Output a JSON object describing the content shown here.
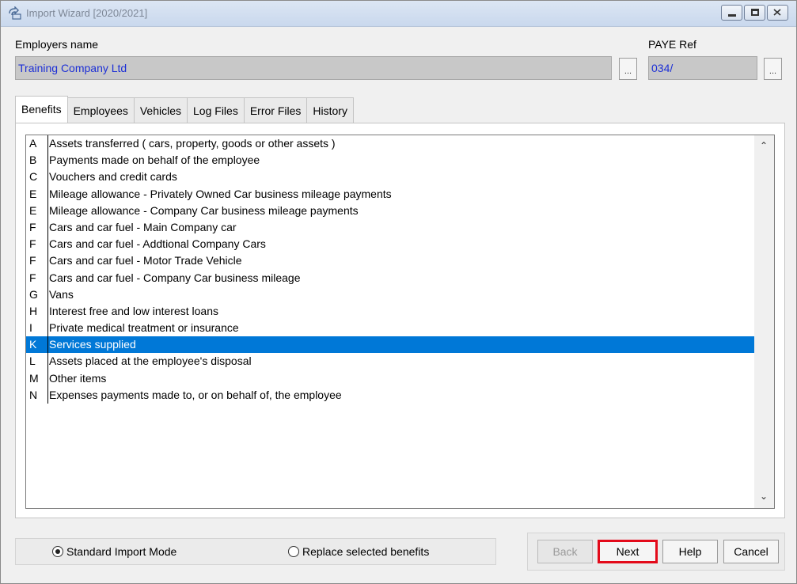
{
  "window": {
    "title": "Import Wizard [2020/2021]"
  },
  "header": {
    "employers_label": "Employers name",
    "employers_value": "Training Company Ltd",
    "paye_label": "PAYE Ref",
    "paye_value": "034/",
    "browse_label": "..."
  },
  "tabs": [
    "Benefits",
    "Employees",
    "Vehicles",
    "Log Files",
    "Error Files",
    "History"
  ],
  "benefits": [
    {
      "code": "A",
      "desc": "Assets transferred ( cars, property, goods or other assets )"
    },
    {
      "code": "B",
      "desc": "Payments made on behalf of the employee"
    },
    {
      "code": "C",
      "desc": "Vouchers and credit cards"
    },
    {
      "code": "E",
      "desc": "Mileage allowance - Privately Owned Car business mileage payments"
    },
    {
      "code": "E",
      "desc": "Mileage allowance - Company Car business mileage payments"
    },
    {
      "code": "F",
      "desc": "Cars and car fuel - Main Company car"
    },
    {
      "code": "F",
      "desc": "Cars and car fuel - Addtional Company Cars"
    },
    {
      "code": "F",
      "desc": "Cars and car fuel - Motor Trade Vehicle"
    },
    {
      "code": "F",
      "desc": "Cars and car fuel - Company Car business mileage"
    },
    {
      "code": "G",
      "desc": "Vans"
    },
    {
      "code": "H",
      "desc": "Interest free and low interest loans"
    },
    {
      "code": "I",
      "desc": "Private medical treatment or insurance"
    },
    {
      "code": "K",
      "desc": "Services supplied"
    },
    {
      "code": "L",
      "desc": "Assets placed at the employee's disposal"
    },
    {
      "code": "M",
      "desc": "Other items"
    },
    {
      "code": "N",
      "desc": "Expenses payments made to, or on behalf of, the employee"
    }
  ],
  "selected_index": 12,
  "mode": {
    "standard": "Standard Import Mode",
    "replace": "Replace selected benefits",
    "selected": "standard"
  },
  "buttons": {
    "back": "Back",
    "next": "Next",
    "help": "Help",
    "cancel": "Cancel"
  },
  "colors": {
    "selection": "#0078d7",
    "field_text": "#1c2fd6",
    "highlight": "#e30a1a"
  }
}
